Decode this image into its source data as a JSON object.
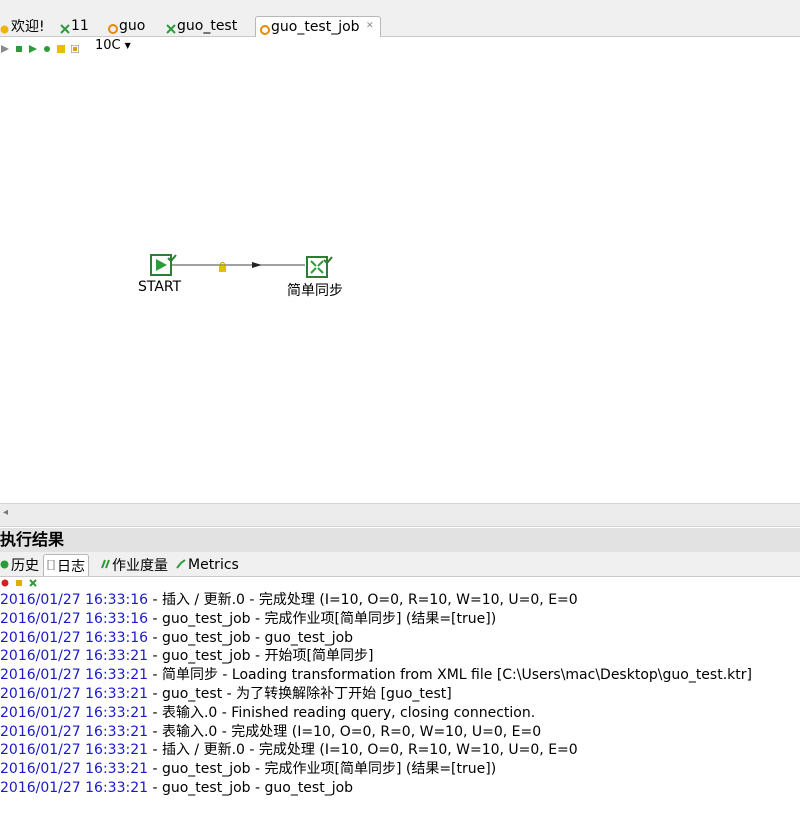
{
  "tabs": [
    {
      "label": "欢迎!",
      "icon": "welcome-icon"
    },
    {
      "label": "11",
      "icon": "job-icon"
    },
    {
      "label": "guo",
      "icon": "transformation-icon"
    },
    {
      "label": "guo_test",
      "icon": "job-icon"
    },
    {
      "label": "guo_test_job",
      "icon": "transformation-icon",
      "active": true
    }
  ],
  "toolbar": {
    "zoom": "10C",
    "icons": [
      "run-icon",
      "stop-icon",
      "play-icon",
      "debug-icon",
      "preview-icon",
      "settings-icon"
    ]
  },
  "canvas": {
    "nodes": [
      {
        "label": "START",
        "icon": "start-play-icon"
      },
      {
        "label": "简单同步",
        "icon": "transformation-node-icon"
      }
    ],
    "hop_icon": "lock-icon"
  },
  "results": {
    "title": "执行结果",
    "tabs": [
      {
        "label": "历史",
        "icon": "history-icon"
      },
      {
        "label": "日志",
        "icon": "log-icon",
        "active": true
      },
      {
        "label": "作业度量",
        "icon": "job-metrics-icon"
      },
      {
        "label": "Metrics",
        "icon": "metrics-icon"
      }
    ],
    "log_tools": [
      "clear-log-icon",
      "copy-log-icon",
      "settings-icon"
    ]
  },
  "log": [
    {
      "ts": "2016/01/27 16:33:16",
      "msg": " - 插入 / 更新.0 - 完成处理 (I=10, O=0, R=10, W=10, U=0, E=0"
    },
    {
      "ts": "2016/01/27 16:33:16",
      "msg": " - guo_test_job - 完成作业项[简单同步] (结果=[true])"
    },
    {
      "ts": "2016/01/27 16:33:16",
      "msg": " - guo_test_job - guo_test_job"
    },
    {
      "ts": "2016/01/27 16:33:21",
      "msg": " - guo_test_job - 开始项[简单同步]"
    },
    {
      "ts": "2016/01/27 16:33:21",
      "msg": " - 简单同步 - Loading transformation from XML file [C:\\Users\\mac\\Desktop\\guo_test.ktr]"
    },
    {
      "ts": "2016/01/27 16:33:21",
      "msg": " - guo_test - 为了转换解除补丁开始  [guo_test]"
    },
    {
      "ts": "2016/01/27 16:33:21",
      "msg": " - 表输入.0 - Finished reading query, closing connection."
    },
    {
      "ts": "2016/01/27 16:33:21",
      "msg": " - 表输入.0 - 完成处理 (I=10, O=0, R=0, W=10, U=0, E=0"
    },
    {
      "ts": "2016/01/27 16:33:21",
      "msg": " - 插入 / 更新.0 - 完成处理 (I=10, O=0, R=10, W=10, U=0, E=0"
    },
    {
      "ts": "2016/01/27 16:33:21",
      "msg": " - guo_test_job - 完成作业项[简单同步] (结果=[true])"
    },
    {
      "ts": "2016/01/27 16:33:21",
      "msg": " - guo_test_job - guo_test_job"
    }
  ]
}
